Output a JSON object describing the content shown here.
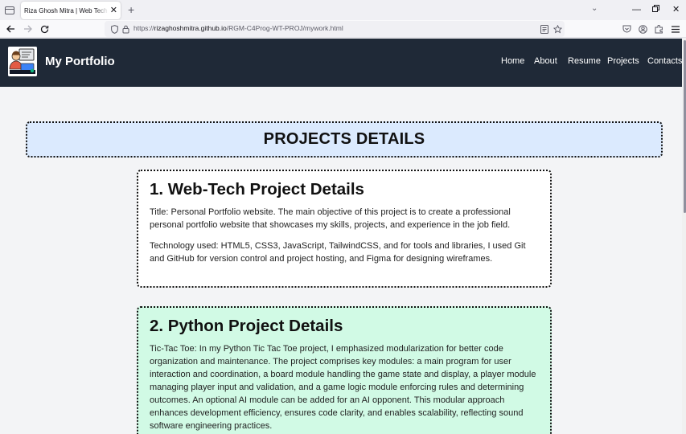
{
  "browser": {
    "tab_title": "Riza Ghosh Mitra | Web Tech | Certificate",
    "url_prefix": "https://",
    "url_host": "rizaghoshmitra.github.io",
    "url_path": "/RGM-C4Prog-WT-PROJ/mywork.html"
  },
  "site": {
    "title": "My Portfolio",
    "nav": [
      "Home",
      "About",
      "Resume",
      "Projects",
      "Contacts"
    ]
  },
  "page": {
    "heading": "PROJECTS DETAILS",
    "projects": [
      {
        "title": "1. Web-Tech Project Details",
        "paragraphs": [
          "Title: Personal Portfolio website. The main objective of this project is to create a professional personal portfolio website that showcases my skills, projects, and experience in the job field.",
          "Technology used: HTML5, CSS3, JavaScript, TailwindCSS, and for tools and libraries, I used Git and GitHub for version control and project hosting, and Figma for designing wireframes."
        ]
      },
      {
        "title": "2. Python Project Details",
        "paragraphs": [
          "Tic-Tac Toe: In my Python Tic Tac Toe project, I emphasized modularization for better code organization and maintenance. The project comprises key modules: a main program for user interaction and coordination, a board module handling the game state and display, a player module managing player input and validation, and a game logic module enforcing rules and determining outcomes. An optional AI module can be added for an AI opponent. This modular approach enhances development efficiency, ensures code clarity, and enables scalability, reflecting sound software engineering practices."
        ]
      }
    ]
  },
  "colors": {
    "header_bg": "#1f2937",
    "banner_bg": "#dbeafe",
    "card1_bg": "#ffffff",
    "card2_bg": "#d1fae5"
  }
}
